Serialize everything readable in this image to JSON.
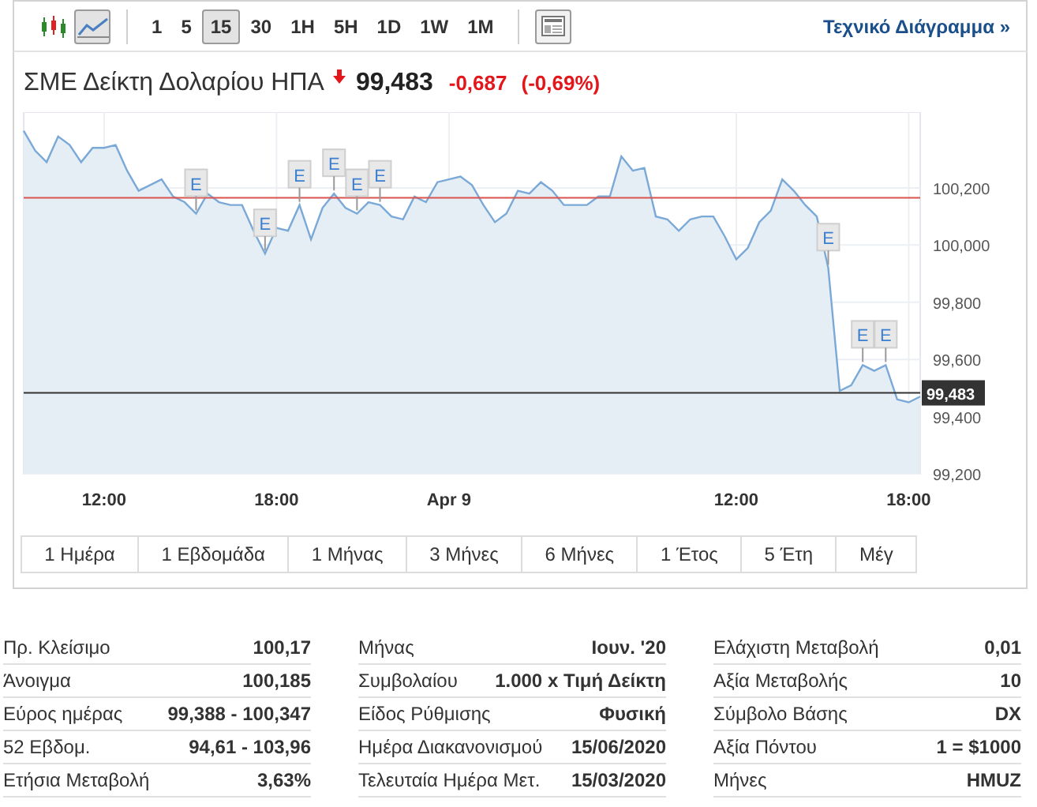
{
  "toolbar": {
    "chart_types": [
      {
        "kind": "candles",
        "selected": false
      },
      {
        "kind": "line",
        "selected": true
      }
    ],
    "intervals": [
      {
        "label": "1",
        "selected": false
      },
      {
        "label": "5",
        "selected": false
      },
      {
        "label": "15",
        "selected": true
      },
      {
        "label": "30",
        "selected": false
      },
      {
        "label": "1H",
        "selected": false
      },
      {
        "label": "5H",
        "selected": false
      },
      {
        "label": "1D",
        "selected": false
      },
      {
        "label": "1W",
        "selected": false
      },
      {
        "label": "1M",
        "selected": false
      }
    ],
    "link": "Τεχνικό Διάγραμμα »"
  },
  "quote": {
    "name": "ΣΜΕ Δείκτη Δολαρίου ΗΠΑ",
    "price": "99,483",
    "change": "-0,687",
    "change_percent": "(-0,69%)"
  },
  "chart": {
    "chart_data": {
      "type": "area",
      "grid": true,
      "ylim": [
        99.2,
        100.465
      ],
      "yticks": [
        {
          "value": 99.2,
          "label": "99,200"
        },
        {
          "value": 99.4,
          "label": "99,400"
        },
        {
          "value": 99.6,
          "label": "99,600"
        },
        {
          "value": 99.8,
          "label": "99,800"
        },
        {
          "value": 100.0,
          "label": "100,000"
        },
        {
          "value": 100.2,
          "label": "100,200"
        }
      ],
      "categories": [
        null,
        null,
        null,
        null,
        null,
        null,
        null,
        "12:00",
        null,
        null,
        null,
        null,
        null,
        null,
        null,
        null,
        null,
        null,
        null,
        null,
        null,
        null,
        "18:00",
        null,
        null,
        null,
        null,
        null,
        null,
        null,
        null,
        null,
        null,
        null,
        null,
        null,
        null,
        "Apr 9",
        null,
        null,
        null,
        null,
        null,
        null,
        null,
        null,
        null,
        null,
        null,
        null,
        null,
        null,
        null,
        null,
        null,
        null,
        null,
        null,
        null,
        null,
        null,
        null,
        "12:00",
        null,
        null,
        null,
        null,
        null,
        null,
        null,
        null,
        null,
        null,
        null,
        null,
        null,
        null,
        "18:00",
        null
      ],
      "series": [
        {
          "color": "#7aa9d8",
          "values": [
            100.4,
            100.33,
            100.29,
            100.38,
            100.35,
            100.29,
            100.34,
            100.34,
            100.35,
            100.26,
            100.19,
            100.21,
            100.23,
            100.17,
            100.15,
            100.11,
            100.18,
            100.15,
            100.14,
            100.14,
            100.05,
            99.97,
            100.06,
            100.05,
            100.14,
            100.02,
            100.13,
            100.18,
            100.13,
            100.11,
            100.15,
            100.14,
            100.1,
            100.09,
            100.17,
            100.15,
            100.22,
            100.23,
            100.24,
            100.21,
            100.14,
            100.08,
            100.11,
            100.19,
            100.18,
            100.22,
            100.19,
            100.14,
            100.14,
            100.14,
            100.17,
            100.17,
            100.31,
            100.26,
            100.27,
            100.1,
            100.09,
            100.05,
            100.09,
            100.1,
            100.1,
            100.03,
            99.95,
            99.99,
            100.08,
            100.12,
            100.23,
            100.19,
            100.14,
            100.1,
            99.92,
            99.49,
            99.51,
            99.58,
            99.56,
            99.58,
            99.46,
            99.45,
            99.47
          ]
        },
        {
          "type": "line",
          "color": "#d9534f",
          "values": [
            100.165,
            100.165,
            100.165,
            100.165,
            100.165,
            100.165,
            100.165,
            100.165,
            100.165,
            100.165,
            100.165,
            100.165,
            100.165,
            100.165,
            100.165,
            100.165,
            100.165,
            100.165,
            100.165,
            100.165,
            100.165,
            100.165,
            100.165,
            100.165,
            100.165,
            100.165,
            100.165,
            100.165,
            100.165,
            100.165,
            100.165,
            100.165,
            100.165,
            100.165,
            100.165,
            100.165,
            100.165,
            100.165,
            100.165,
            100.165,
            100.165,
            100.165,
            100.165,
            100.165,
            100.165,
            100.165,
            100.165,
            100.165,
            100.165,
            100.165,
            100.165,
            100.165,
            100.165,
            100.165,
            100.165,
            100.165,
            100.165,
            100.165,
            100.165,
            100.165,
            100.165,
            100.165,
            100.165,
            100.165,
            100.165,
            100.165,
            100.165,
            100.165,
            100.165,
            100.165,
            100.165,
            100.165,
            100.165,
            100.165,
            100.165,
            100.165,
            100.165,
            100.165,
            100.165
          ]
        },
        {
          "type": "line",
          "color": "#333333",
          "values": [
            99.483,
            99.483,
            99.483,
            99.483,
            99.483,
            99.483,
            99.483,
            99.483,
            99.483,
            99.483,
            99.483,
            99.483,
            99.483,
            99.483,
            99.483,
            99.483,
            99.483,
            99.483,
            99.483,
            99.483,
            99.483,
            99.483,
            99.483,
            99.483,
            99.483,
            99.483,
            99.483,
            99.483,
            99.483,
            99.483,
            99.483,
            99.483,
            99.483,
            99.483,
            99.483,
            99.483,
            99.483,
            99.483,
            99.483,
            99.483,
            99.483,
            99.483,
            99.483,
            99.483,
            99.483,
            99.483,
            99.483,
            99.483,
            99.483,
            99.483,
            99.483,
            99.483,
            99.483,
            99.483,
            99.483,
            99.483,
            99.483,
            99.483,
            99.483,
            99.483,
            99.483,
            99.483,
            99.483,
            99.483,
            99.483,
            99.483,
            99.483,
            99.483,
            99.483,
            99.483,
            99.483,
            99.483,
            99.483,
            99.483,
            99.483,
            99.483,
            99.483,
            99.483,
            99.483
          ]
        }
      ],
      "annotations": [
        "99,483"
      ]
    },
    "event_flags": [
      {
        "text": "E"
      },
      {
        "text": "E"
      },
      {
        "text": "E"
      },
      {
        "text": "E"
      },
      {
        "text": "E"
      },
      {
        "text": "E"
      },
      {
        "text": "E"
      },
      {
        "text": "E"
      },
      {
        "text": "E"
      }
    ]
  },
  "ranges": [
    "1 Ημέρα",
    "1 Εβδομάδα",
    "1 Μήνας",
    "3 Μήνες",
    "6 Μήνες",
    "1 Έτος",
    "5 Έτη",
    "Μέγ"
  ],
  "stats": [
    [
      {
        "label": "Πρ. Κλείσιμο",
        "value": "100,17"
      },
      {
        "label": "Άνοιγμα",
        "value": "100,185"
      },
      {
        "label": "Εύρος ημέρας",
        "value": "99,388 - 100,347"
      },
      {
        "label": "52 Εβδομ.",
        "value": "94,61 - 103,96"
      },
      {
        "label": "Ετήσια Μεταβολή",
        "value": "3,63%"
      }
    ],
    [
      {
        "label": "Μήνας",
        "value": "Ιουν. '20"
      },
      {
        "label": "Συμβολαίου",
        "value": "1.000 x Τιμή Δείκτη"
      },
      {
        "label": "Είδος Ρύθμισης",
        "value": "Φυσική"
      },
      {
        "label": "Ημέρα Διακανονισμού",
        "value": "15/06/2020"
      },
      {
        "label": "Τελευταία Ημέρα Μετ.",
        "value": "15/03/2020"
      }
    ],
    [
      {
        "label": "Ελάχιστη Μεταβολή",
        "value": "0,01"
      },
      {
        "label": "Αξία Μεταβολής",
        "value": "10"
      },
      {
        "label": "Σύμβολο Βάσης",
        "value": "DX"
      },
      {
        "label": "Αξία Πόντου",
        "value": "1 = $1000"
      },
      {
        "label": "Μήνες",
        "value": "HMUZ"
      }
    ]
  ]
}
